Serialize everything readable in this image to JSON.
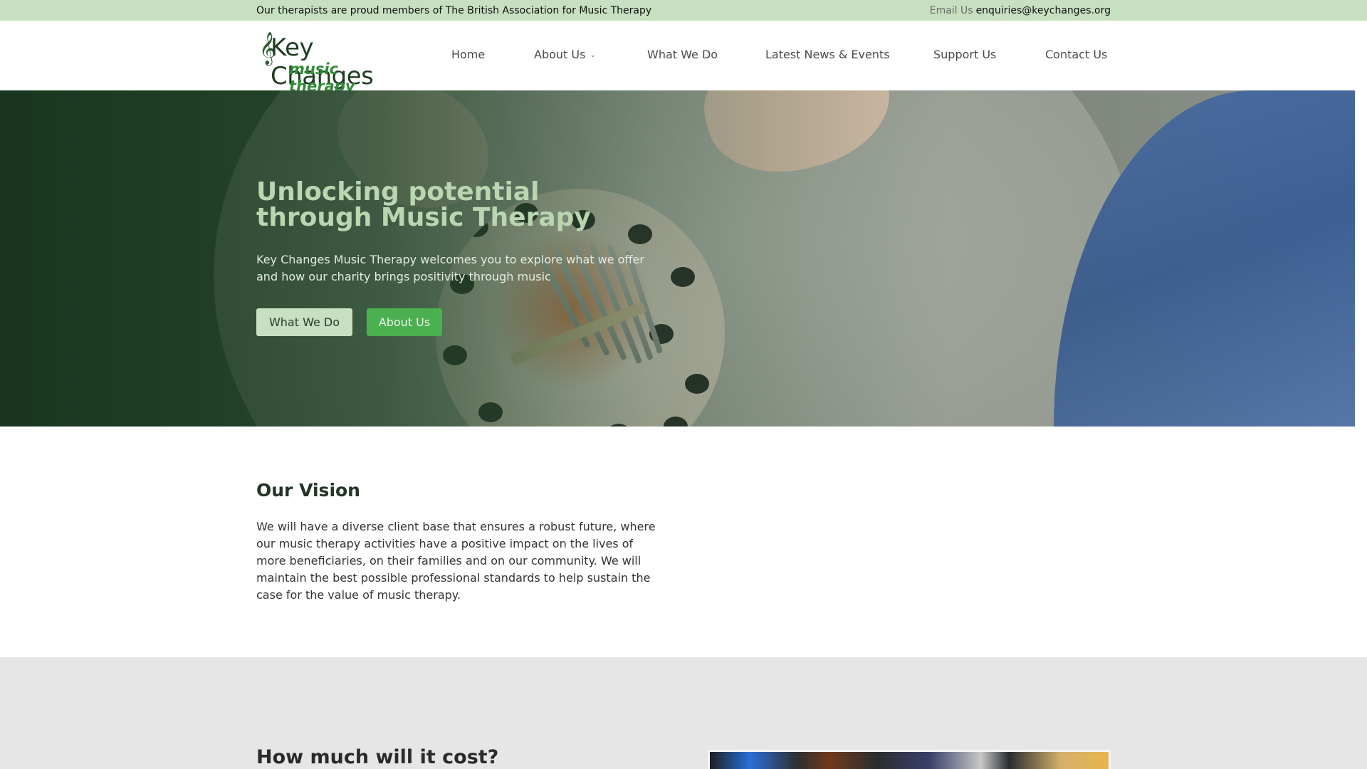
{
  "topbar": {
    "message": "Our therapists are proud members of The British Association for Music Therapy",
    "email_label": "Email Us",
    "email_value": "enquiries@keychanges.org"
  },
  "logo": {
    "name": "Key Changes",
    "tagline": "music therapy",
    "clef_symbol": "𝄞"
  },
  "nav": {
    "items": [
      {
        "label": "Home"
      },
      {
        "label": "About Us",
        "has_dropdown": true
      },
      {
        "label": "What We Do"
      },
      {
        "label": "Latest News & Events"
      },
      {
        "label": "Support Us"
      },
      {
        "label": "Contact Us"
      }
    ],
    "chevron": "⌄"
  },
  "hero": {
    "title": "Unlocking potential through Music Therapy",
    "text": "Key Changes Music Therapy welcomes you to explore what we offer and how our charity brings positivity through music",
    "button_primary": "What We Do",
    "button_secondary": "About Us"
  },
  "vision": {
    "title": "Our Vision",
    "text": "We will have a diverse client base that ensures a robust future, where our music therapy activities have a positive impact on the lives of more beneficiaries, on their families and on our community. We will maintain the best possible professional standards to help sustain the case for the value of music therapy."
  },
  "cost": {
    "title": "How much will it cost?"
  },
  "colors": {
    "topbar_bg": "#c6e0c1",
    "accent_green": "#4caf50",
    "light_green": "#c6e0c1",
    "hero_title": "#b9d6b1",
    "section_grey": "#e6e6e6"
  }
}
